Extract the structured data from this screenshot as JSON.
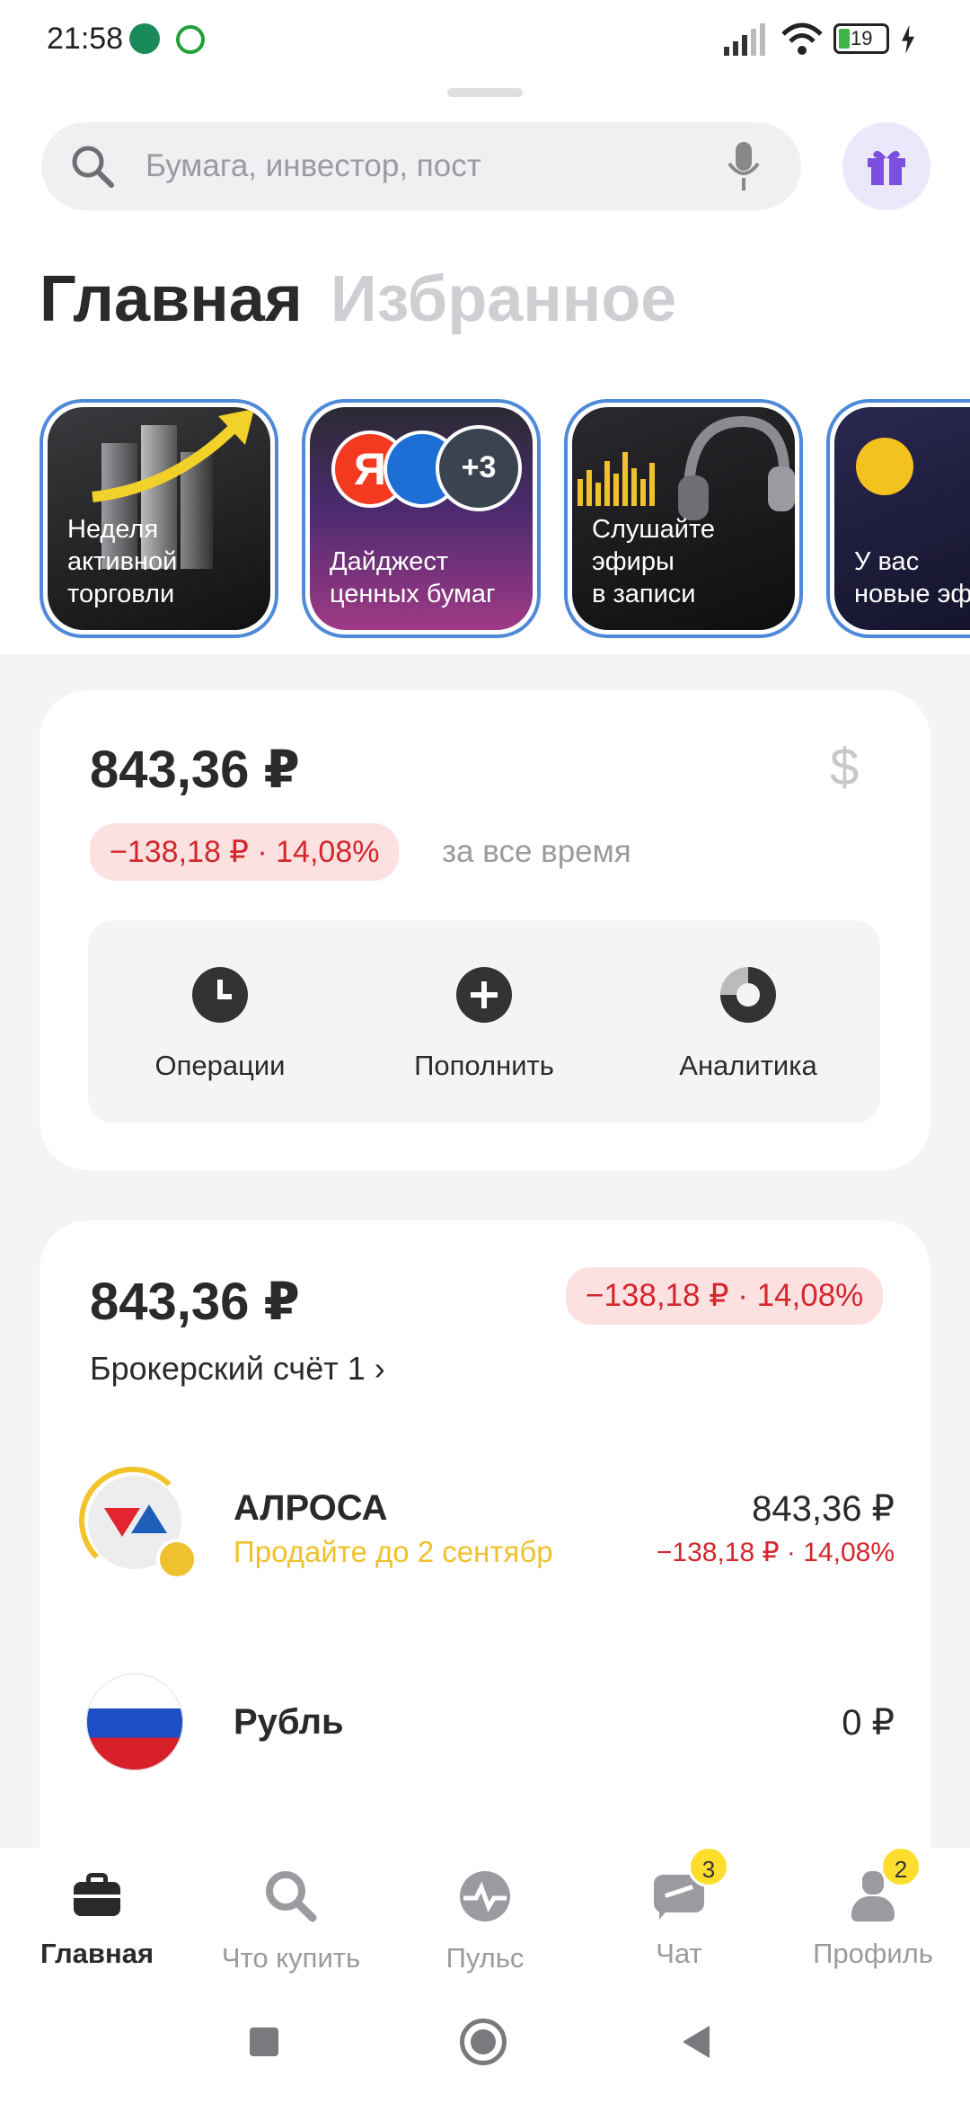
{
  "status_bar": {
    "time": "21:58",
    "battery": "19"
  },
  "search": {
    "placeholder": "Бумага, инвестор, пост"
  },
  "tabs": {
    "main": "Главная",
    "favorites": "Избранное"
  },
  "stories": [
    {
      "label_line1": "Неделя",
      "label_line2": "активной",
      "label_line3": "торговли"
    },
    {
      "label_line1": "Дайджест",
      "label_line2": "ценных бумаг",
      "badge": "+3"
    },
    {
      "label_line1": "Слушайте",
      "label_line2": "эфиры",
      "label_line3": "в записи"
    },
    {
      "label_line1": "У вас",
      "label_line2": "новые эф"
    }
  ],
  "portfolio": {
    "total": "843,36 ₽",
    "change": "−138,18 ₽ · 14,08%",
    "period": "за все время",
    "currency_icon": "$",
    "actions": [
      {
        "label": "Операции",
        "icon": "clock-icon"
      },
      {
        "label": "Пополнить",
        "icon": "plus-icon"
      },
      {
        "label": "Аналитика",
        "icon": "pie-chart-icon"
      }
    ]
  },
  "account": {
    "total": "843,36 ₽",
    "change": "−138,18 ₽ · 14,08%",
    "name": "Брокерский счёт 1 ›",
    "positions": [
      {
        "name": "АЛРОСА",
        "subtitle": "Продайте до 2 сентябр",
        "value": "843,36 ₽",
        "change": "−138,18 ₽ · 14,08%"
      },
      {
        "name": "Рубль",
        "value": "0 ₽"
      }
    ]
  },
  "bottom_nav": [
    {
      "label": "Главная",
      "active": true
    },
    {
      "label": "Что купить"
    },
    {
      "label": "Пульс"
    },
    {
      "label": "Чат",
      "badge": "3"
    },
    {
      "label": "Профиль",
      "badge": "2"
    }
  ],
  "colors": {
    "accent_red": "#d4262c",
    "brand_yellow": "#ffdd2d",
    "story_border": "#4f8ad9",
    "subtitle_yellow": "#f0c12e"
  }
}
